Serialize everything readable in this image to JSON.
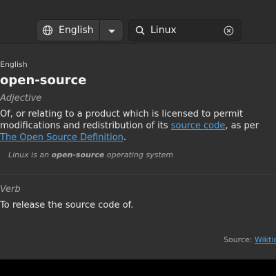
{
  "header": {
    "language": "English",
    "search_value": "Linux"
  },
  "entry": {
    "language": "English",
    "word": "open-source",
    "sections": [
      {
        "part_of_speech": "Adjective",
        "definition_prefix": "Of, or relating to a product which is licensed to permit modifications and redistribution of its ",
        "link1": "source code",
        "definition_middle": ", as per ",
        "link2": "The Open Source Definition",
        "definition_suffix": ".",
        "example_prefix": "Linux is an ",
        "example_term": "open-source",
        "example_suffix": " operating system"
      },
      {
        "part_of_speech": "Verb",
        "definition": "To release the source code of."
      }
    ]
  },
  "footer": {
    "source_label": "Source: ",
    "source_link": "Wiktionary"
  },
  "colors": {
    "accent": "#4fa3e6",
    "background": "#303030"
  }
}
